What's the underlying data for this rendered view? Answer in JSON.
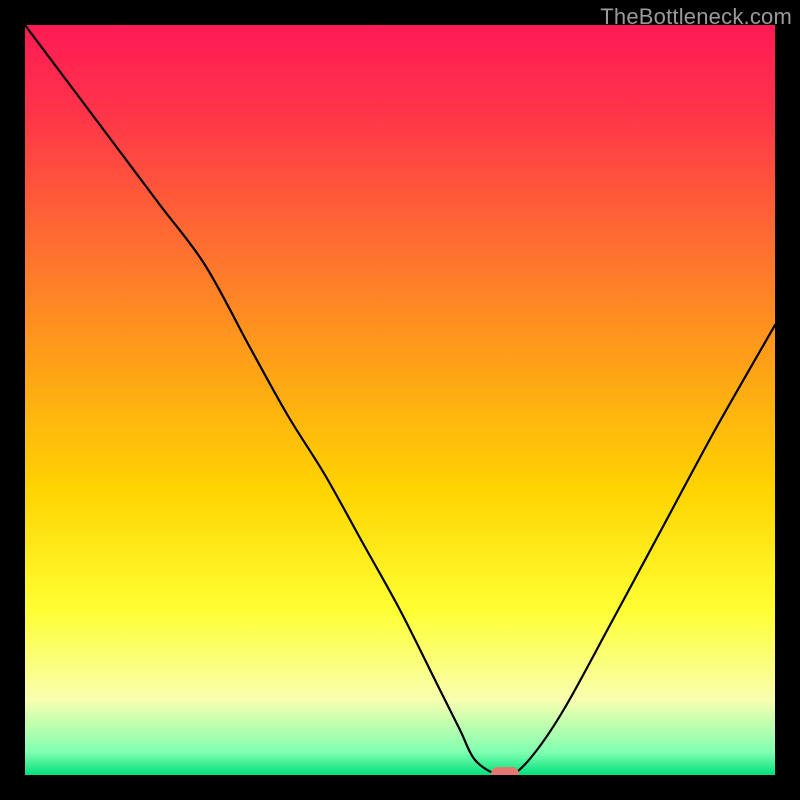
{
  "watermark": {
    "text": "TheBottleneck.com"
  },
  "chart_data": {
    "type": "line",
    "title": "",
    "xlabel": "",
    "ylabel": "",
    "xlim": [
      0,
      100
    ],
    "ylim": [
      0,
      100
    ],
    "series": [
      {
        "name": "curve",
        "x": [
          0,
          6,
          12,
          18,
          24,
          30,
          35,
          40,
          45,
          50,
          55,
          58,
          60,
          63,
          65,
          68,
          72,
          78,
          85,
          92,
          100
        ],
        "y": [
          100,
          92,
          84,
          76,
          68,
          57,
          48,
          40,
          31,
          22,
          12,
          6,
          2,
          0,
          0,
          3,
          9,
          20,
          33,
          46,
          60
        ]
      }
    ],
    "marker": {
      "x": 64,
      "y": 0,
      "color": "#e2786f"
    },
    "background_gradient": {
      "stops": [
        {
          "offset": 0.0,
          "color": "#ff1a55"
        },
        {
          "offset": 0.12,
          "color": "#ff3549"
        },
        {
          "offset": 0.28,
          "color": "#ff6a32"
        },
        {
          "offset": 0.45,
          "color": "#ffa018"
        },
        {
          "offset": 0.62,
          "color": "#ffd400"
        },
        {
          "offset": 0.78,
          "color": "#ffff33"
        },
        {
          "offset": 0.9,
          "color": "#f8ffb0"
        },
        {
          "offset": 0.97,
          "color": "#7fffb0"
        },
        {
          "offset": 1.0,
          "color": "#00e07a"
        }
      ]
    }
  }
}
